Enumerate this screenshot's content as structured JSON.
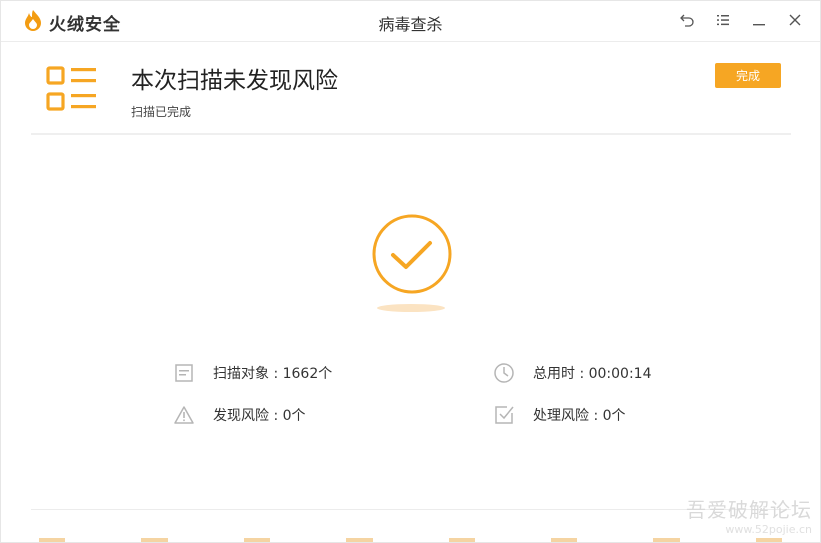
{
  "app": {
    "logo_text": "火绒安全",
    "window_title": "病毒查杀"
  },
  "controls": [
    "back-icon",
    "menu-icon",
    "minimize-icon",
    "close-icon"
  ],
  "header": {
    "title": "本次扫描未发现风险",
    "subtitle": "扫描已完成",
    "done_button": "完成"
  },
  "stats": {
    "scan_objects": "扫描对象 : 1662个",
    "total_time": "总用时 : 00:00:14",
    "found_risks": "发现风险 : 0个",
    "handled_risks": "处理风险 : 0个"
  },
  "watermark": {
    "main": "吾爱破解论坛",
    "sub": "www.52pojie.cn"
  },
  "colors": {
    "accent": "#f6a623",
    "text": "#333333",
    "icon_gray": "#b5b5b5"
  }
}
